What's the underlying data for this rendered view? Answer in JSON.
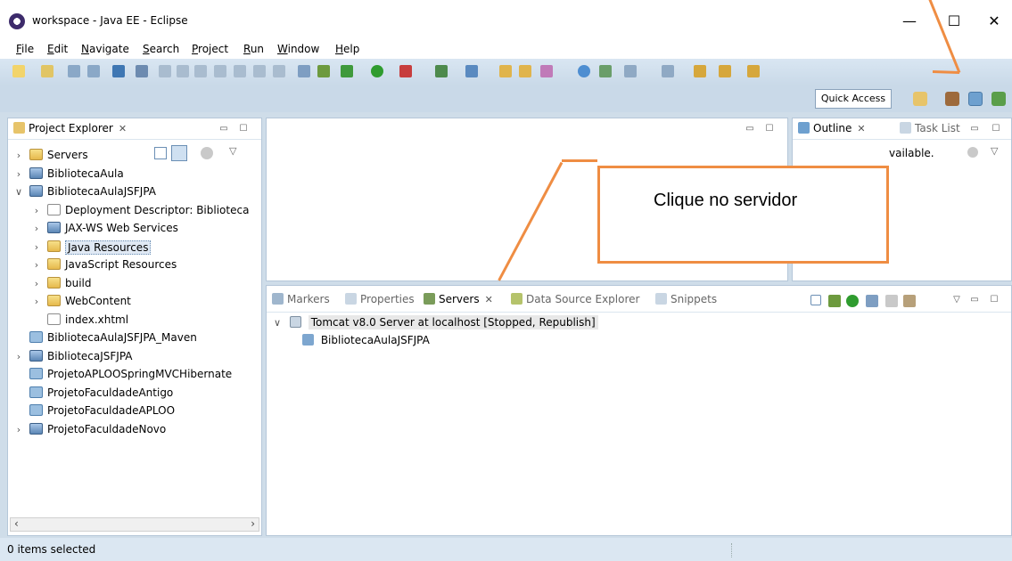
{
  "window": {
    "title": "workspace - Java EE - Eclipse",
    "minimize": "—",
    "maximize": "☐",
    "close": "✕"
  },
  "menu": [
    "File",
    "Edit",
    "Navigate",
    "Search",
    "Project",
    "Run",
    "Window",
    "Help"
  ],
  "toolbar": {
    "quick_access": "Quick Access"
  },
  "project_explorer": {
    "tab_label": "Project Explorer",
    "tree": [
      {
        "label": "Servers",
        "icon": "folder-icon",
        "arrow": ">"
      },
      {
        "label": "BibliotecaAula",
        "icon": "web-project-icon",
        "arrow": ">"
      },
      {
        "label": "BibliotecaAulaJSFJPA",
        "icon": "web-project-icon",
        "arrow": "v"
      },
      {
        "label": "Deployment Descriptor: Biblioteca",
        "icon": "descriptor-icon",
        "arrow": ">"
      },
      {
        "label": "JAX-WS Web Services",
        "icon": "webservice-icon",
        "arrow": ">"
      },
      {
        "label": "Java Resources",
        "icon": "java-resources-icon",
        "arrow": ">"
      },
      {
        "label": "JavaScript Resources",
        "icon": "javascript-icon",
        "arrow": ">"
      },
      {
        "label": "build",
        "icon": "folder-icon",
        "arrow": ">"
      },
      {
        "label": "WebContent",
        "icon": "folder-icon",
        "arrow": ">"
      },
      {
        "label": "index.xhtml",
        "icon": "file-icon",
        "arrow": ""
      },
      {
        "label": "BibliotecaAulaJSFJPA_Maven",
        "icon": "closed-project-icon",
        "arrow": ""
      },
      {
        "label": "BibliotecaJSFJPA",
        "icon": "maven-project-icon",
        "arrow": ">"
      },
      {
        "label": "ProjetoAPLOOSpringMVCHibernate",
        "icon": "closed-project-icon",
        "arrow": ""
      },
      {
        "label": "ProjetoFaculdadeAntigo",
        "icon": "closed-project-icon",
        "arrow": ""
      },
      {
        "label": "ProjetoFaculdadeAPLOO",
        "icon": "closed-project-icon",
        "arrow": ""
      },
      {
        "label": "ProjetoFaculdadeNovo",
        "icon": "web-project-icon",
        "arrow": ">"
      }
    ]
  },
  "outline": {
    "tab_label": "Outline",
    "task_list_label": "Task List",
    "message": "vailable."
  },
  "bottom_panel": {
    "tabs": [
      "Markers",
      "Properties",
      "Servers",
      "Data Source Explorer",
      "Snippets"
    ],
    "active_tab": "Servers",
    "server": "Tomcat v8.0 Server at localhost  [Stopped, Republish]",
    "module": "BibliotecaAulaJSFJPA"
  },
  "callout": {
    "text": "Clique no servidor"
  },
  "status_bar": {
    "text": "0 items selected"
  },
  "colors": {
    "callout_border": "#ef8d43",
    "toolbar_bg": "#cfdde9"
  }
}
